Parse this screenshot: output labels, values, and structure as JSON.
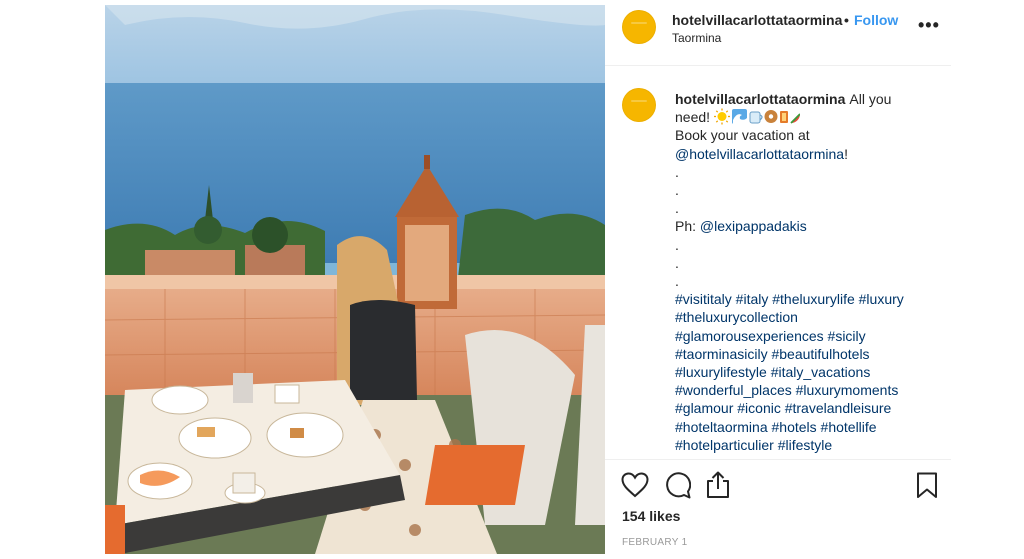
{
  "post": {
    "username": "hotelvillacarlottataormina",
    "separator": "•",
    "follow_label": "Follow",
    "location": "Taormina",
    "more_label": "•••",
    "caption": {
      "username": "hotelvillacarlottataormina",
      "first_text": "All you",
      "line2_text": "need!",
      "line3_text": "Book your vacation at",
      "mention1": "@hotelvillacarlottataormina",
      "mention1_suffix": "!",
      "dot1": ".",
      "dot2": ".",
      "dot3": ".",
      "ph_label": "Ph:",
      "mention2": "@lexipappadakis",
      "dot4": ".",
      "dot5": ".",
      "dot6": ".",
      "hashtag_lines": [
        "#visititaly #italy #theluxurylife #luxury",
        "#theluxurycollection",
        "#glamorousexperiences #sicily",
        "#taorminasicily #beautifulhotels",
        "#luxurylifestyle #italy_vacations",
        "#wonderful_places #luxurymoments",
        "#glamour #iconic #travelandleisure",
        "#hoteltaormina #hotels #hotellife",
        "#hotelparticulier #lifestyle"
      ]
    },
    "likes_text": "154 likes",
    "date_text": "FEBRUARY 1",
    "colors": {
      "link": "#003569",
      "follow": "#3897f0",
      "avatar": "#f6b600"
    },
    "icons": [
      "heart-icon",
      "comment-icon",
      "share-icon",
      "bookmark-icon"
    ]
  }
}
